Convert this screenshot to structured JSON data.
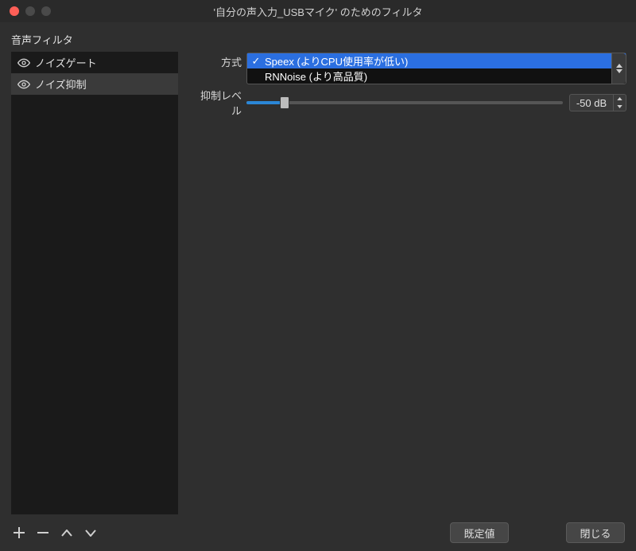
{
  "window": {
    "title": "'自分の声入力_USBマイク' のためのフィルタ"
  },
  "sidebar": {
    "title": "音声フィルタ",
    "items": [
      {
        "label": "ノイズゲート"
      },
      {
        "label": "ノイズ抑制"
      }
    ]
  },
  "main": {
    "method_label": "方式",
    "dropdown": {
      "options": [
        {
          "label": "Speex (よりCPU使用率が低い)",
          "selected": true
        },
        {
          "label": "RNNoise (より高品質)",
          "selected": false
        }
      ]
    },
    "suppress_label": "抑制レベル",
    "suppress_value": "-50 dB"
  },
  "footer": {
    "defaults": "既定値",
    "close": "閉じる"
  }
}
